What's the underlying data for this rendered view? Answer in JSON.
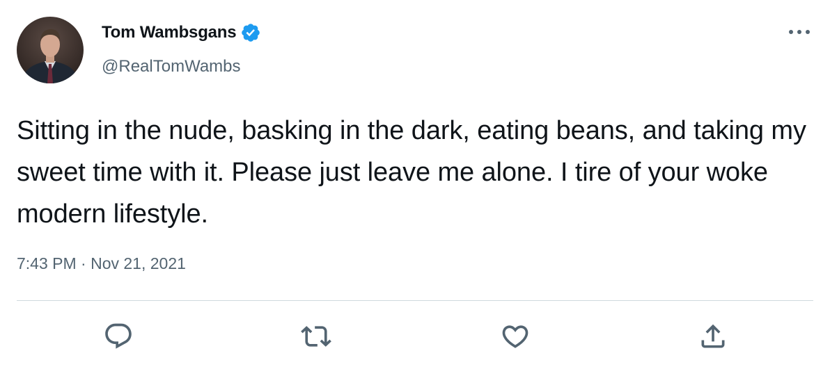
{
  "tweet": {
    "author": {
      "display_name": "Tom Wambsgans",
      "handle": "@RealTomWambs",
      "verified": true
    },
    "text": "Sitting in the nude, basking in the dark, eating beans, and taking my sweet time with it. Please just leave me alone. I tire of your woke modern lifestyle.",
    "timestamp": "7:43 PM · Nov 21, 2021",
    "actions": [
      {
        "name": "reply",
        "icon": "reply-icon"
      },
      {
        "name": "retweet",
        "icon": "retweet-icon"
      },
      {
        "name": "like",
        "icon": "heart-icon"
      },
      {
        "name": "share",
        "icon": "share-icon"
      }
    ]
  },
  "colors": {
    "text_primary": "#0f1419",
    "text_secondary": "#536471",
    "verified_blue": "#1d9bf0",
    "divider": "#cfd9de"
  }
}
